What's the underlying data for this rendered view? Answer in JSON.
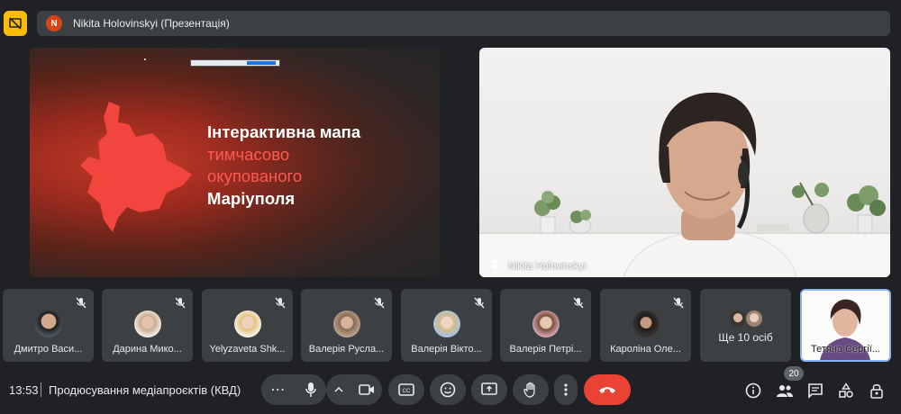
{
  "topbar": {
    "avatar_letter": "N",
    "presenter_title": "Nikita Holovinskyi (Презентація)"
  },
  "slide": {
    "line1": "Інтерактивна мапа",
    "line2": "тимчасово",
    "line3": "окупованого",
    "line4": "Маріуполя"
  },
  "camera": {
    "name": "Nikita Holovinskyi"
  },
  "participants": [
    {
      "name": "Дмитро Васи..."
    },
    {
      "name": "Дарина Мико..."
    },
    {
      "name": "Yelyzaveta Shk..."
    },
    {
      "name": "Валерія Русла..."
    },
    {
      "name": "Валерія Вікто..."
    },
    {
      "name": "Валерія Петрі..."
    },
    {
      "name": "Кароліна Оле..."
    },
    {
      "name": "Ще 10 осіб"
    },
    {
      "name": "Тетяна Сергії..."
    }
  ],
  "bottombar": {
    "time": "13:53",
    "meeting_title": "Продюсування медіапроєктів (КВД)",
    "participant_count": "20"
  },
  "colors": {
    "background": "#202124",
    "tile": "#3c4043",
    "end_call": "#ea4335",
    "presenting": "#fbbc04",
    "accent_red": "#ff5a4f"
  }
}
